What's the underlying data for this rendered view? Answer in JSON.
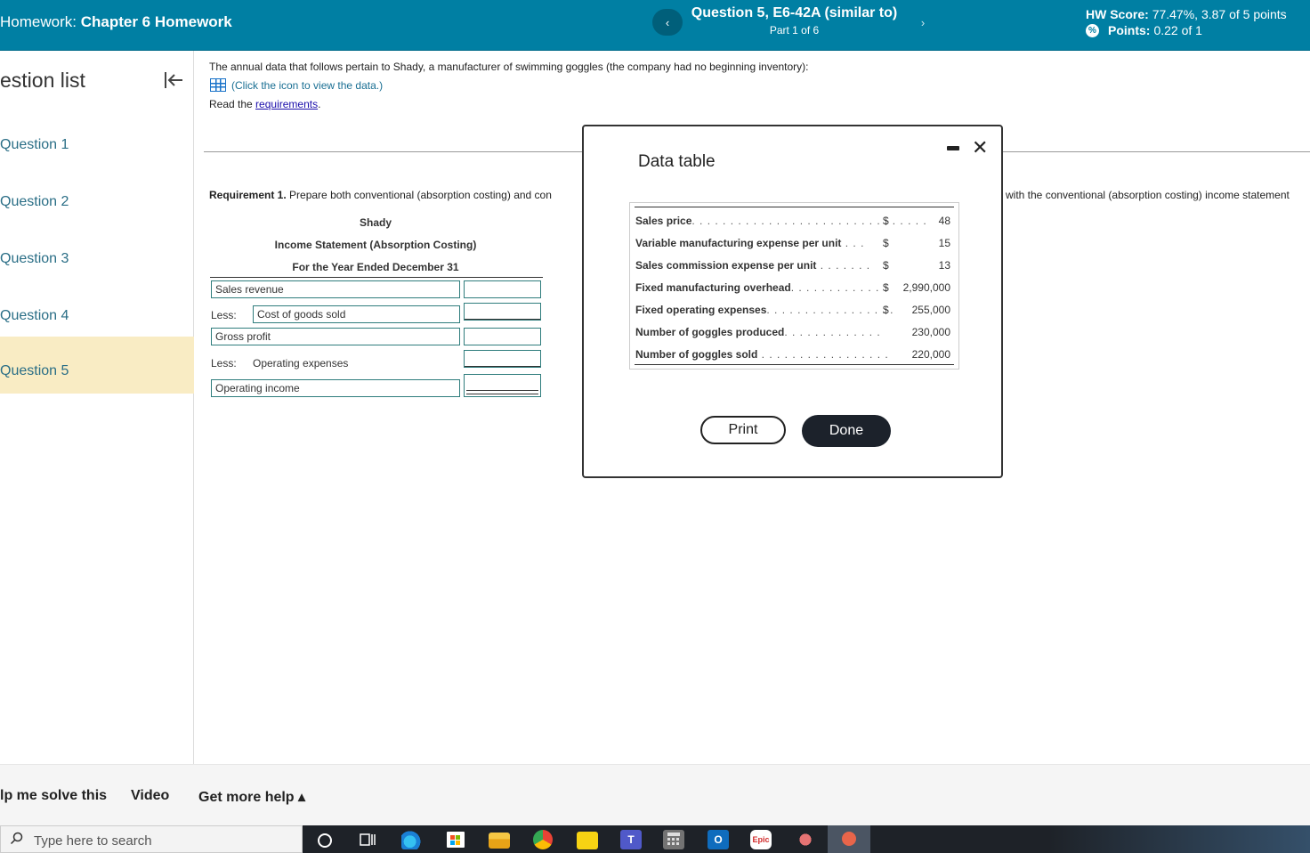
{
  "header": {
    "hw_prefix": "Homework:",
    "hw_title": "Chapter 6 Homework",
    "question_title": "Question 5, E6-42A (similar to)",
    "question_part": "Part 1 of 6",
    "prev_label": "‹",
    "next_label": "›",
    "score_label": "HW Score:",
    "score_value": "77.47%, 3.87 of 5 points",
    "points_label": "Points:",
    "points_value": "0.22 of 1"
  },
  "sidebar": {
    "title": "estion list",
    "collapse_icon": "|←",
    "items": [
      {
        "label": "Question 1"
      },
      {
        "label": "Question 2"
      },
      {
        "label": "Question 3"
      },
      {
        "label": "Question 4"
      },
      {
        "label": "Question 5"
      }
    ]
  },
  "main": {
    "intro": "The annual data that follows pertain to Shady, a manufacturer of swimming goggles (the company had no beginning inventory):",
    "icon_text": "(Click the icon to view the data.)",
    "read_prefix": "Read the ",
    "read_link": "requirements",
    "read_suffix": ".",
    "req_label": "Requirement 1.",
    "req_text": " Prepare both conventional (absorption costing) and con",
    "req_tail": "with the conventional (absorption costing) income statement"
  },
  "statement": {
    "company": "Shady",
    "title": "Income Statement (Absorption Costing)",
    "period": "For the Year Ended December 31",
    "sales_revenue": "Sales revenue",
    "less1": "Less:",
    "cogs": "Cost of goods sold",
    "gross_profit": "Gross profit",
    "less2": "Less:",
    "opex": "Operating expenses",
    "op_income": "Operating income"
  },
  "modal": {
    "title": "Data table",
    "rows": [
      {
        "label": "Sales price",
        "dots": ". . . . . . . . . . . . . . . . . . . . . . . . . . . . . . .",
        "cur": "$",
        "value": "48"
      },
      {
        "label": "Variable manufacturing expense per unit",
        "dots": " . . .",
        "cur": "$",
        "value": "15"
      },
      {
        "label": "Sales commission expense per unit",
        "dots": " . . . . . . .",
        "cur": "$",
        "value": "13"
      },
      {
        "label": "Fixed manufacturing overhead",
        "dots": ". . . . . . . . . . . .",
        "cur": "$",
        "value": "2,990,000"
      },
      {
        "label": "Fixed operating expenses",
        "dots": ". . . . . . . . . . . . . . . . .",
        "cur": "$",
        "value": "255,000"
      },
      {
        "label": "Number of goggles produced",
        "dots": ". . . . . . . . . . . . .",
        "cur": "",
        "value": "230,000"
      },
      {
        "label": "Number of goggles sold",
        "dots": " . . . . . . . . . . . . . . . . .",
        "cur": "",
        "value": "220,000"
      }
    ],
    "print_label": "Print",
    "done_label": "Done"
  },
  "helpbar": {
    "help_me": "lp me solve this",
    "video": "Video",
    "more_help": "Get more help ▴"
  },
  "taskbar": {
    "search_placeholder": "Type here to search",
    "search_icon": "search-icon",
    "epic_label": "Epic"
  }
}
